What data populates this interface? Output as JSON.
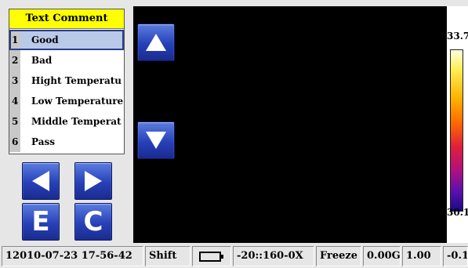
{
  "menu": {
    "title": "Text Comment",
    "items": [
      {
        "num": "1",
        "label": "Good"
      },
      {
        "num": "2",
        "label": "Bad"
      },
      {
        "num": "3",
        "label": "Hight Temperatu"
      },
      {
        "num": "4",
        "label": "Low Temperature"
      },
      {
        "num": "5",
        "label": "Middle Temperat"
      },
      {
        "num": "6",
        "label": "Pass"
      }
    ],
    "selected_index": 0
  },
  "scale": {
    "max": "33.7",
    "min": "30.1"
  },
  "buttons": {
    "e_label": "E",
    "c_label": "C"
  },
  "status": {
    "datetime": "12010-07-23 17-56-42",
    "shift": "Shift",
    "range": "-20::160-0X",
    "freeze": "Freeze",
    "gain": "0.00G",
    "emissivity": "1.00",
    "offset": "-0.1"
  },
  "colors": {
    "menu_title_bg": "#ffff00",
    "selected_bg": "#b9c9e8",
    "button_blue": "#2740b8",
    "screen_bg": "#000000"
  }
}
